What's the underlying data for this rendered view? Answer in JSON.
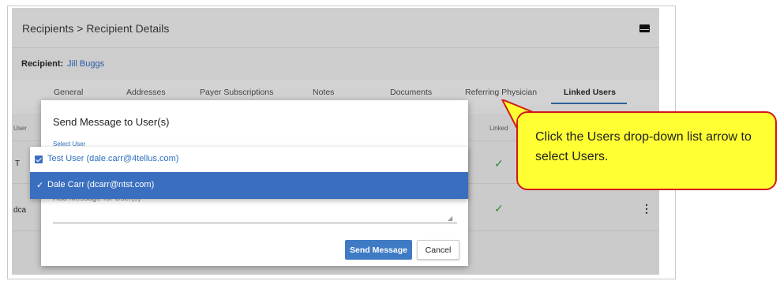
{
  "breadcrumb": "Recipients > Recipient Details",
  "recipient": {
    "label": "Recipient:",
    "name": "Jill Buggs"
  },
  "tabs": [
    {
      "label": "General"
    },
    {
      "label": "Addresses"
    },
    {
      "label": "Payer Subscriptions"
    },
    {
      "label": "Notes"
    },
    {
      "label": "Documents"
    },
    {
      "label": "Referring Physician"
    },
    {
      "label": "Linked Users",
      "active": true
    }
  ],
  "table": {
    "col_user": "User",
    "col_linked": "Linked",
    "rows": [
      {
        "user_partial": "T",
        "linked_icon": "check-icon"
      },
      {
        "user_partial": "dca",
        "linked_icon": "check-icon"
      }
    ]
  },
  "dialog": {
    "title": "Send Message to User(s)",
    "select_label": "Select User",
    "options": [
      {
        "label": "Test User (dale.carr@4tellus.com)",
        "checked": true
      },
      {
        "label": "Dale Carr (dcarr@ntst.com)",
        "checked": true,
        "highlighted": true
      }
    ],
    "message_placeholder": "Add Message for User(s)",
    "send_label": "Send Message",
    "cancel_label": "Cancel"
  },
  "callout": {
    "text": "Click the Users drop-down list arrow to select Users."
  },
  "colors": {
    "accent": "#3e7bc4",
    "callout_fill": "#ffff33",
    "callout_border": "#d11a1a",
    "check": "#3a8a3a"
  }
}
